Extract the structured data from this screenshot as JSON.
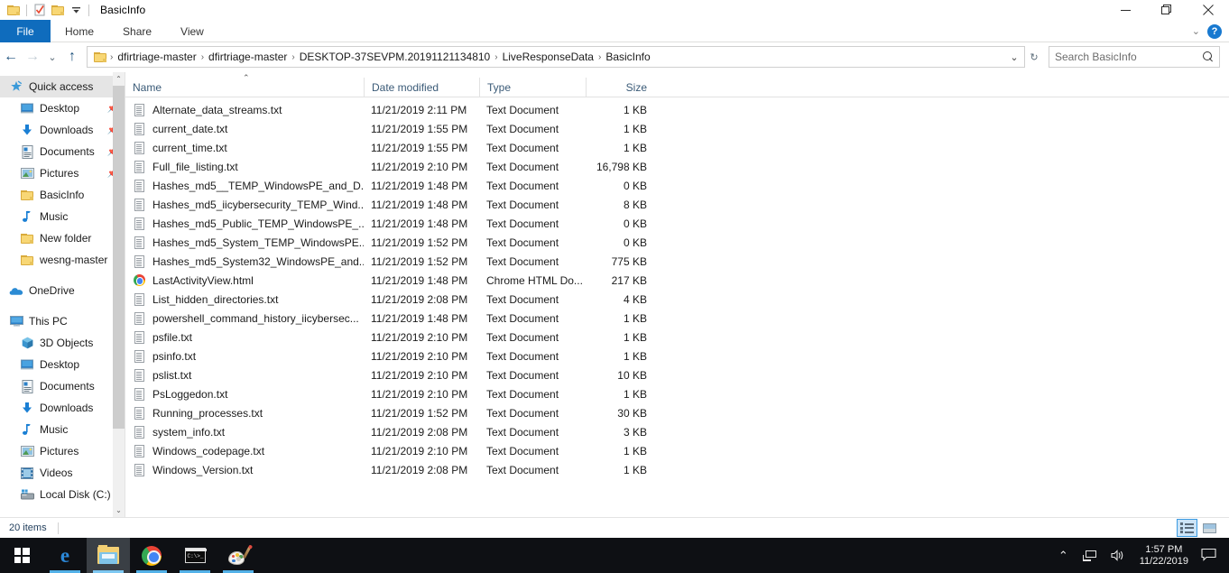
{
  "window": {
    "title": "BasicInfo",
    "quick_access_toolbar": [
      {
        "name": "folder-icon",
        "label": ""
      },
      {
        "name": "properties-icon",
        "label": ""
      },
      {
        "name": "new-folder-icon",
        "label": ""
      },
      {
        "name": "customize-dropdown-icon",
        "label": "▾"
      }
    ],
    "controls": {
      "minimize": "—",
      "maximize": "❐",
      "close": "✕"
    }
  },
  "ribbon": {
    "tabs": [
      {
        "label": "File",
        "active_file": true
      },
      {
        "label": "Home",
        "active_file": false
      },
      {
        "label": "Share",
        "active_file": false
      },
      {
        "label": "View",
        "active_file": false
      }
    ],
    "expand_label": "⌄",
    "help_label": "?"
  },
  "address": {
    "back_label": "←",
    "forward_label": "→",
    "recent_label": "⌄",
    "up_label": "↑",
    "breadcrumbs": [
      "dfirtriage-master",
      "dfirtriage-master",
      "DESKTOP-37SEVPM.20191121134810",
      "LiveResponseData",
      "BasicInfo"
    ],
    "separator": "›",
    "history_dropdown_label": "⌄",
    "refresh_label": "↻"
  },
  "search": {
    "placeholder": "Search BasicInfo",
    "value": "",
    "icon": "search-icon"
  },
  "sidebar": {
    "groups": [
      {
        "header": {
          "label": "Quick access",
          "icon": "pin-star-icon",
          "selected": true
        },
        "items": [
          {
            "label": "Desktop",
            "icon": "desktop-icon",
            "pinned": true
          },
          {
            "label": "Downloads",
            "icon": "downloads-arrow-icon",
            "pinned": true
          },
          {
            "label": "Documents",
            "icon": "documents-icon",
            "pinned": true
          },
          {
            "label": "Pictures",
            "icon": "pictures-icon",
            "pinned": true
          },
          {
            "label": "BasicInfo",
            "icon": "folder-icon",
            "pinned": false
          },
          {
            "label": "Music",
            "icon": "music-note-icon",
            "pinned": false
          },
          {
            "label": "New folder",
            "icon": "folder-icon",
            "pinned": false
          },
          {
            "label": "wesng-master",
            "icon": "folder-icon",
            "pinned": false
          }
        ]
      },
      {
        "header": {
          "label": "OneDrive",
          "icon": "onedrive-cloud-icon",
          "selected": false
        },
        "items": []
      },
      {
        "header": {
          "label": "This PC",
          "icon": "this-pc-icon",
          "selected": false
        },
        "items": [
          {
            "label": "3D Objects",
            "icon": "3d-objects-icon",
            "pinned": false
          },
          {
            "label": "Desktop",
            "icon": "desktop-icon",
            "pinned": false
          },
          {
            "label": "Documents",
            "icon": "documents-icon",
            "pinned": false
          },
          {
            "label": "Downloads",
            "icon": "downloads-arrow-icon",
            "pinned": false
          },
          {
            "label": "Music",
            "icon": "music-note-icon",
            "pinned": false
          },
          {
            "label": "Pictures",
            "icon": "pictures-icon",
            "pinned": false
          },
          {
            "label": "Videos",
            "icon": "videos-icon",
            "pinned": false
          },
          {
            "label": "Local Disk (C:)",
            "icon": "local-disk-icon",
            "pinned": false
          }
        ]
      }
    ],
    "scroll_up_label": "⌃",
    "scroll_down_label": "⌄"
  },
  "filelist": {
    "columns": [
      {
        "label": "Name",
        "sorted": true,
        "sort_direction": "ascending",
        "sort_glyph": "⌃"
      },
      {
        "label": "Date modified",
        "sorted": false
      },
      {
        "label": "Type",
        "sorted": false
      },
      {
        "label": "Size",
        "sorted": false
      }
    ],
    "rows": [
      {
        "name": "Alternate_data_streams.txt",
        "date": "11/21/2019 2:11 PM",
        "type": "Text Document",
        "size": "1 KB",
        "icon": "text-document-icon"
      },
      {
        "name": "current_date.txt",
        "date": "11/21/2019 1:55 PM",
        "type": "Text Document",
        "size": "1 KB",
        "icon": "text-document-icon"
      },
      {
        "name": "current_time.txt",
        "date": "11/21/2019 1:55 PM",
        "type": "Text Document",
        "size": "1 KB",
        "icon": "text-document-icon"
      },
      {
        "name": "Full_file_listing.txt",
        "date": "11/21/2019 2:10 PM",
        "type": "Text Document",
        "size": "16,798 KB",
        "icon": "text-document-icon"
      },
      {
        "name": "Hashes_md5__TEMP_WindowsPE_and_D...",
        "date": "11/21/2019 1:48 PM",
        "type": "Text Document",
        "size": "0 KB",
        "icon": "text-document-icon"
      },
      {
        "name": "Hashes_md5_iicybersecurity_TEMP_Wind...",
        "date": "11/21/2019 1:48 PM",
        "type": "Text Document",
        "size": "8 KB",
        "icon": "text-document-icon"
      },
      {
        "name": "Hashes_md5_Public_TEMP_WindowsPE_...",
        "date": "11/21/2019 1:48 PM",
        "type": "Text Document",
        "size": "0 KB",
        "icon": "text-document-icon"
      },
      {
        "name": "Hashes_md5_System_TEMP_WindowsPE...",
        "date": "11/21/2019 1:52 PM",
        "type": "Text Document",
        "size": "0 KB",
        "icon": "text-document-icon"
      },
      {
        "name": "Hashes_md5_System32_WindowsPE_and...",
        "date": "11/21/2019 1:52 PM",
        "type": "Text Document",
        "size": "775 KB",
        "icon": "text-document-icon"
      },
      {
        "name": "LastActivityView.html",
        "date": "11/21/2019 1:48 PM",
        "type": "Chrome HTML Do...",
        "size": "217 KB",
        "icon": "chrome-html-icon"
      },
      {
        "name": "List_hidden_directories.txt",
        "date": "11/21/2019 2:08 PM",
        "type": "Text Document",
        "size": "4 KB",
        "icon": "text-document-icon"
      },
      {
        "name": "powershell_command_history_iicybersec...",
        "date": "11/21/2019 1:48 PM",
        "type": "Text Document",
        "size": "1 KB",
        "icon": "text-document-icon"
      },
      {
        "name": "psfile.txt",
        "date": "11/21/2019 2:10 PM",
        "type": "Text Document",
        "size": "1 KB",
        "icon": "text-document-icon"
      },
      {
        "name": "psinfo.txt",
        "date": "11/21/2019 2:10 PM",
        "type": "Text Document",
        "size": "1 KB",
        "icon": "text-document-icon"
      },
      {
        "name": "pslist.txt",
        "date": "11/21/2019 2:10 PM",
        "type": "Text Document",
        "size": "10 KB",
        "icon": "text-document-icon"
      },
      {
        "name": "PsLoggedon.txt",
        "date": "11/21/2019 2:10 PM",
        "type": "Text Document",
        "size": "1 KB",
        "icon": "text-document-icon"
      },
      {
        "name": "Running_processes.txt",
        "date": "11/21/2019 1:52 PM",
        "type": "Text Document",
        "size": "30 KB",
        "icon": "text-document-icon"
      },
      {
        "name": "system_info.txt",
        "date": "11/21/2019 2:08 PM",
        "type": "Text Document",
        "size": "3 KB",
        "icon": "text-document-icon"
      },
      {
        "name": "Windows_codepage.txt",
        "date": "11/21/2019 2:10 PM",
        "type": "Text Document",
        "size": "1 KB",
        "icon": "text-document-icon"
      },
      {
        "name": "Windows_Version.txt",
        "date": "11/21/2019 2:08 PM",
        "type": "Text Document",
        "size": "1 KB",
        "icon": "text-document-icon"
      }
    ]
  },
  "statusbar": {
    "item_count": "20 items",
    "view_buttons": [
      {
        "name": "details-view-button",
        "selected": true
      },
      {
        "name": "large-icons-view-button",
        "selected": false
      }
    ]
  },
  "taskbar": {
    "items": [
      {
        "name": "start-button",
        "icon": "windows-logo-icon",
        "state": "idle"
      },
      {
        "name": "taskbar-edge",
        "icon": "edge-icon",
        "state": "running"
      },
      {
        "name": "taskbar-file-explorer",
        "icon": "file-explorer-icon",
        "state": "active"
      },
      {
        "name": "taskbar-chrome",
        "icon": "chrome-icon",
        "state": "running"
      },
      {
        "name": "taskbar-command-prompt",
        "icon": "command-prompt-icon",
        "state": "running"
      },
      {
        "name": "taskbar-paint",
        "icon": "paint-icon",
        "state": "running"
      }
    ],
    "tray": {
      "show_hidden_label": "⌃",
      "network_icon": "network-icon",
      "volume_icon": "volume-icon",
      "time": "1:57 PM",
      "date": "11/22/2019",
      "action_center_icon": "notification-icon"
    }
  },
  "colors": {
    "accent": "#0f6cbd",
    "file_tab_blue": "#0f6cbd",
    "header_text": "#3a5a77",
    "selection_gray": "#e5e5e5",
    "taskbar_bg": "#0e1014",
    "folder_yellow": "#f8d775",
    "view_selected": "#cce4f7"
  }
}
